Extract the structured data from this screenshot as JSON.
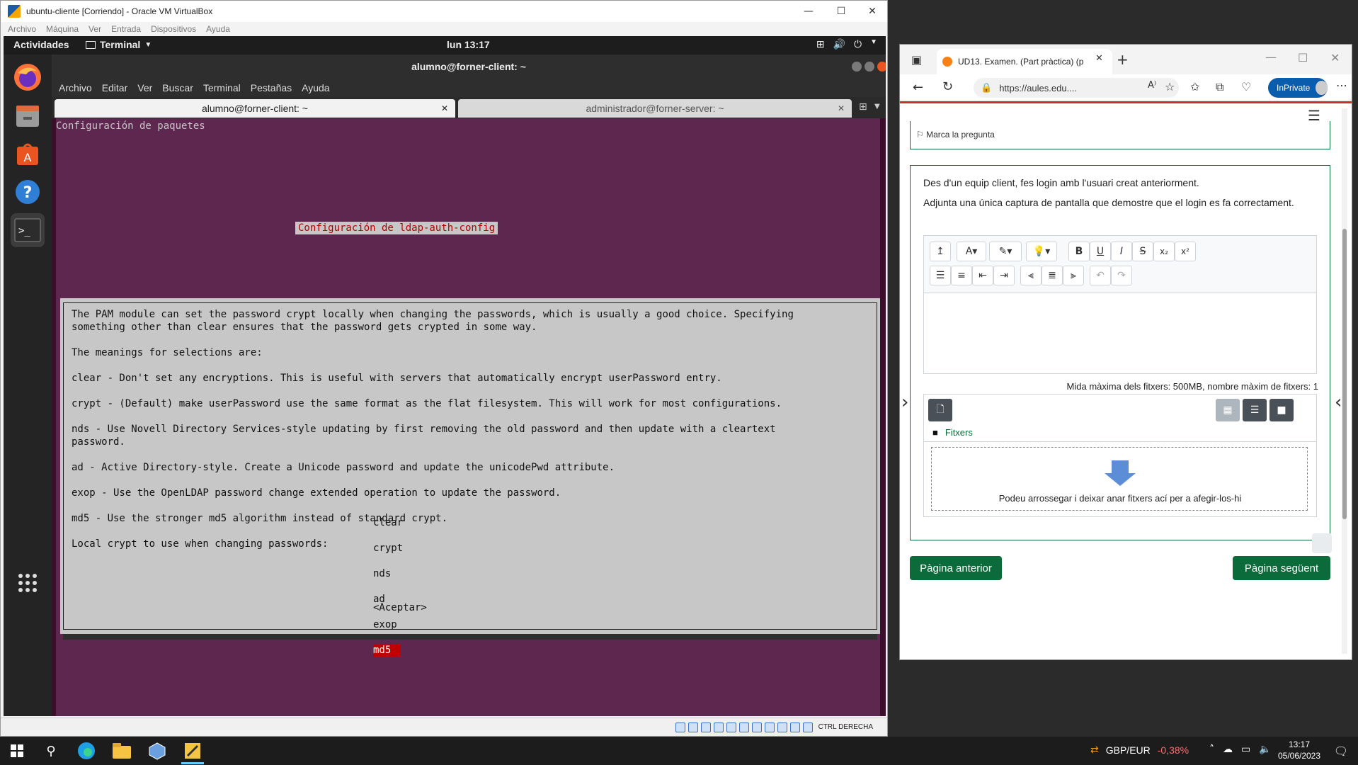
{
  "vbox": {
    "title": "ubuntu-cliente [Corriendo] - Oracle VM VirtualBox",
    "menu": [
      "Archivo",
      "Máquina",
      "Ver",
      "Entrada",
      "Dispositivos",
      "Ayuda"
    ],
    "status_hostkey": "CTRL DERECHA"
  },
  "gnome": {
    "activities": "Actividades",
    "app": "Terminal",
    "clock": "lun 13:17"
  },
  "terminal": {
    "title": "alumno@forner-client: ~",
    "menu": [
      "Archivo",
      "Editar",
      "Ver",
      "Buscar",
      "Terminal",
      "Pestañas",
      "Ayuda"
    ],
    "tabs": [
      "alumno@forner-client: ~",
      "administrador@forner-server: ~"
    ],
    "header": "Configuración de paquetes",
    "dialog": {
      "title": "Configuración de ldap-auth-config",
      "lines": [
        "The PAM module can set the password crypt locally when changing the passwords, which is usually a good choice. Specifying",
        "something other than clear ensures that the password gets crypted in some way.",
        "",
        "The meanings for selections are:",
        "",
        "clear - Don't set any encryptions. This is useful with servers that automatically encrypt userPassword entry.",
        "",
        "crypt - (Default) make userPassword use the same format as the flat filesystem. This will work for most configurations.",
        "",
        "nds - Use Novell Directory Services-style updating by first removing the old password and then update with a cleartext",
        "password.",
        "",
        "ad - Active Directory-style. Create a Unicode password and update the unicodePwd attribute.",
        "",
        "exop - Use the OpenLDAP password change extended operation to update the password.",
        "",
        "md5 - Use the stronger md5 algorithm instead of standard crypt.",
        "",
        "Local crypt to use when changing passwords:"
      ],
      "options": [
        "clear",
        "crypt",
        "nds",
        "ad",
        "exop",
        "md5"
      ],
      "selected": "md5",
      "accept": "<Aceptar>"
    }
  },
  "edge": {
    "tab_title": "UD13. Examen. (Part pràctica) (p",
    "url": "https://aules.edu....",
    "inprivate": "InPrivate",
    "flag_label": "Marca la pregunta",
    "question_line1": "Des d'un equip client, fes login amb l'usuari creat anteriorment.",
    "question_line2": "Adjunta una única captura de pantalla que demostre que el login es fa correctament.",
    "max_files": "Mida màxima dels fitxers: 500MB, nombre màxim de fitxers: 1",
    "files_label": "Fitxers",
    "drop_hint": "Podeu arrossegar i deixar anar fitxers ací per a afegir-los-hi",
    "prev_button": "Pàgina anterior",
    "next_button": "Pàgina següent"
  },
  "taskbar": {
    "ticker": "GBP/EUR",
    "ticker_change": "-0,38%",
    "time": "13:17",
    "date": "05/06/2023"
  },
  "colors": {
    "terminal_bg": "#5e2750",
    "dialog_bg": "#c7c7c7",
    "selection": "#c00000",
    "moodle_green": "#0b6b3a",
    "inprivate": "#0a5cad"
  }
}
